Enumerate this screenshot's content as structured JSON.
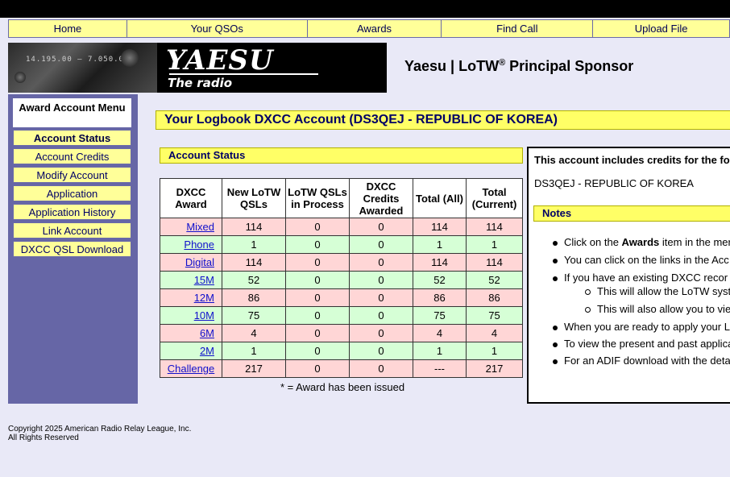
{
  "nav": {
    "items": [
      "Home",
      "Your QSOs",
      "Awards",
      "Find Call",
      "Upload File"
    ]
  },
  "banner": {
    "logo": "YAESU",
    "tagline": "The radio",
    "radio_display": "14.195.00 — 7.050.00",
    "sponsor": "Yaesu | LoTW",
    "sponsor_mark": "®",
    "sponsor_suffix": " Principal Sponsor"
  },
  "menu": {
    "title": "Award Account Menu",
    "items": [
      "Account Status",
      "Account Credits",
      "Modify Account",
      "Application",
      "Application History",
      "Link Account",
      "DXCC QSL Download"
    ],
    "active": "Account Status"
  },
  "page": {
    "title": "Your Logbook DXCC Account (DS3QEJ - REPUBLIC OF KOREA)"
  },
  "status": {
    "heading": "Account Status",
    "columns": [
      "DXCC Award",
      "New LoTW QSLs",
      "LoTW QSLs in Process",
      "DXCC Credits Awarded",
      "Total (All)",
      "Total (Current)"
    ],
    "rows": [
      {
        "award": "Mixed",
        "new": "114",
        "process": "0",
        "credits": "0",
        "total_all": "114",
        "total_current": "114"
      },
      {
        "award": "Phone",
        "new": "1",
        "process": "0",
        "credits": "0",
        "total_all": "1",
        "total_current": "1"
      },
      {
        "award": "Digital",
        "new": "114",
        "process": "0",
        "credits": "0",
        "total_all": "114",
        "total_current": "114"
      },
      {
        "award": "15M",
        "new": "52",
        "process": "0",
        "credits": "0",
        "total_all": "52",
        "total_current": "52"
      },
      {
        "award": "12M",
        "new": "86",
        "process": "0",
        "credits": "0",
        "total_all": "86",
        "total_current": "86"
      },
      {
        "award": "10M",
        "new": "75",
        "process": "0",
        "credits": "0",
        "total_all": "75",
        "total_current": "75"
      },
      {
        "award": "6M",
        "new": "4",
        "process": "0",
        "credits": "0",
        "total_all": "4",
        "total_current": "4"
      },
      {
        "award": "2M",
        "new": "1",
        "process": "0",
        "credits": "0",
        "total_all": "1",
        "total_current": "1"
      },
      {
        "award": "Challenge",
        "new": "217",
        "process": "0",
        "credits": "0",
        "total_all": "---",
        "total_current": "217"
      }
    ],
    "footnote": "* = Award has been issued"
  },
  "info": {
    "title": "This account includes credits for the fol",
    "callsign": "DS3QEJ - REPUBLIC OF KOREA",
    "notes_heading": "Notes",
    "note1_pre": "Click on the ",
    "note1_bold": "Awards",
    "note1_post": " item in the mer",
    "note2": "You can click on the links in the Acc",
    "note3": "If you have an existing DXCC recor",
    "note3a": "This will allow the LoTW syst",
    "note3b": "This will also allow you to vie",
    "note4": "When you are ready to apply your L",
    "note5": "To view the present and past applica",
    "note6": "For an ADIF download with the deta"
  },
  "footer": {
    "line1": "Copyright 2025 American Radio Relay League, Inc.",
    "line2": "All Rights Reserved"
  }
}
